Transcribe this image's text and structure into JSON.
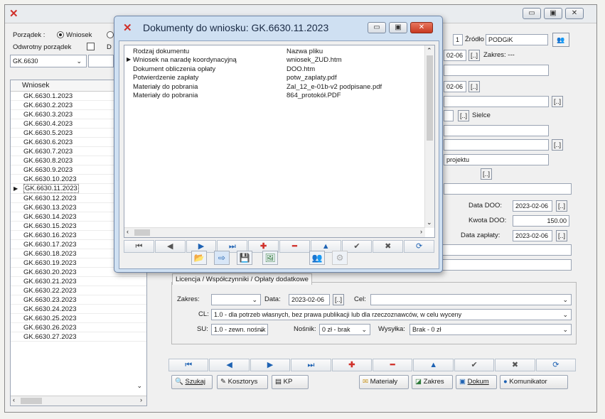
{
  "app": {
    "title_icon": "close-x-icon",
    "sort_label": "Porządek :",
    "sort_option": "Wniosek",
    "reverse_label": "Odwrotny porządek",
    "filter_value": "GK.6630",
    "col_header": "Wniosek",
    "items": [
      "GK.6630.1.2023",
      "GK.6630.2.2023",
      "GK.6630.3.2023",
      "GK.6630.4.2023",
      "GK.6630.5.2023",
      "GK.6630.6.2023",
      "GK.6630.7.2023",
      "GK.6630.8.2023",
      "GK.6630.9.2023",
      "GK.6630.10.2023",
      "GK.6630.11.2023",
      "GK.6630.12.2023",
      "GK.6630.13.2023",
      "GK.6630.14.2023",
      "GK.6630.15.2023",
      "GK.6630.16.2023",
      "GK.6630.17.2023",
      "GK.6630.18.2023",
      "GK.6630.19.2023",
      "GK.6630.20.2023",
      "GK.6630.21.2023",
      "GK.6630.22.2023",
      "GK.6630.23.2023",
      "GK.6630.24.2023",
      "GK.6630.25.2023",
      "GK.6630.26.2023",
      "GK.6630.27.2023"
    ],
    "selected_index": 10
  },
  "right": {
    "partial_num": "1",
    "zrodlo_label": "Źródło",
    "zrodlo_value": "PODGiK",
    "date_partial": "02-06",
    "zakres_label": "Zakres: ---",
    "date_partial2": "02-06",
    "sielce": "Sielce",
    "projektu": "projektu",
    "data_doo_label": "Data DOO:",
    "data_doo": "2023-02-06",
    "kwota_label": "Kwota DOO:",
    "kwota": "150.00",
    "data_zaplaty_label": "Data zapłaty:",
    "data_zaplaty": "2023-02-06"
  },
  "dialog": {
    "title": "Dokumenty do wniosku: GK.6630.11.2023",
    "col1": "Rodzaj dokumentu",
    "col2": "Nazwa pliku",
    "rows": [
      {
        "type": "Wniosek na naradę koordynacyjną",
        "file": "wniosek_ZUD.htm"
      },
      {
        "type": "Dokument obliczenia opłaty",
        "file": "DOO.htm"
      },
      {
        "type": "Potwierdzenie zapłaty",
        "file": "potw_zaplaty.pdf"
      },
      {
        "type": "Materiały do pobrania",
        "file": "Zal_12_e-01b-v2 podpisane.pdf"
      },
      {
        "type": "Materiały do pobrania",
        "file": "864_protokół.PDF"
      }
    ]
  },
  "licencja": {
    "tab_label": "Licencja / Współczynniki / Opłaty dodatkowe",
    "zakres_label": "Zakres:",
    "data_label": "Data:",
    "data_value": "2023-02-06",
    "cel_label": "Cel:",
    "cl_label": "CL:",
    "cl_value": "1.0 - dla potrzeb własnych, bez prawa publikacji  lub dla rzeczoznawców, w celu wyceny",
    "su_label": "SU:",
    "su_value": "1.0 - zewn. nośnik",
    "nosnik_label": "Nośnik:",
    "nosnik_value": "0 zł - brak",
    "wysylka_label": "Wysyłka:",
    "wysylka_value": "Brak - 0 zł"
  },
  "toolbar": {
    "szukaj": "Szukaj",
    "kosztorys": "Kosztorys",
    "kp": "KP",
    "materialy": "Materiały",
    "zakres": "Zakres",
    "dokum": "Dokum",
    "komunikator": "Komunikator"
  }
}
